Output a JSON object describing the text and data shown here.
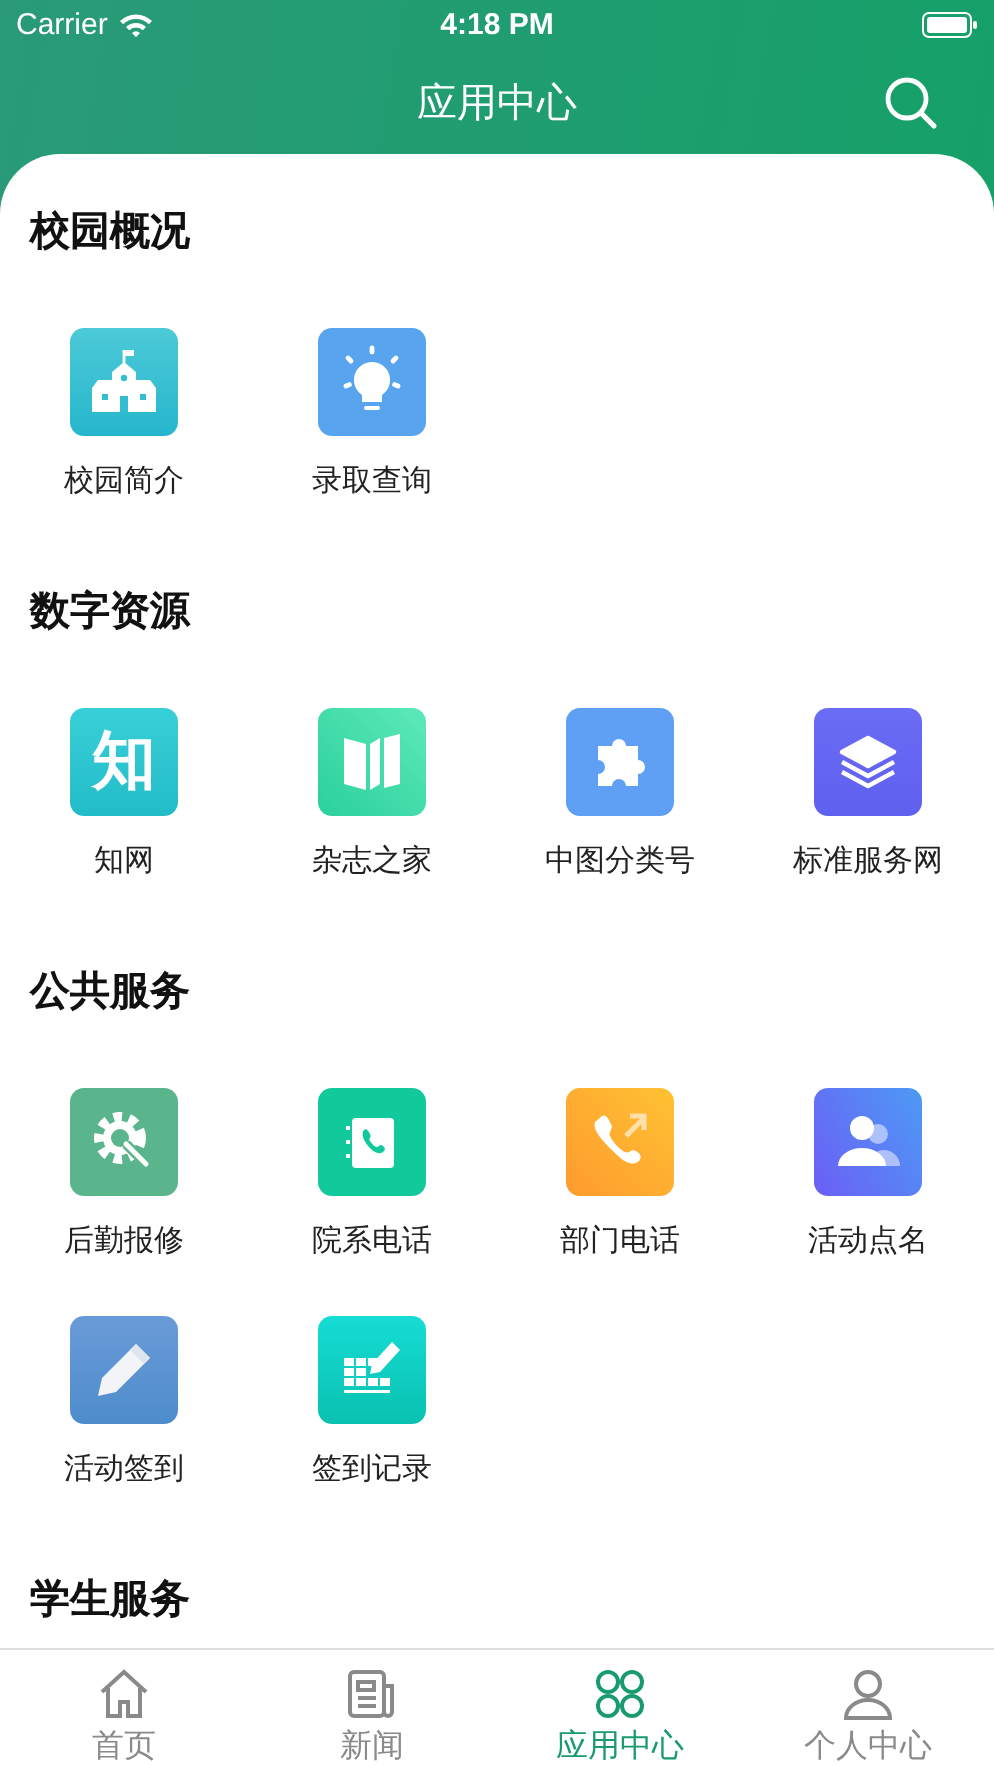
{
  "status_bar": {
    "carrier": "Carrier",
    "time": "4:18 PM"
  },
  "nav_bar": {
    "title": "应用中心"
  },
  "sections": [
    {
      "title": "校园概况",
      "items": [
        {
          "label": "校园简介"
        },
        {
          "label": "录取查询"
        }
      ]
    },
    {
      "title": "数字资源",
      "items": [
        {
          "label": "知网",
          "icon_text": "知"
        },
        {
          "label": "杂志之家"
        },
        {
          "label": "中图分类号"
        },
        {
          "label": "标准服务网"
        }
      ]
    },
    {
      "title": "公共服务",
      "items": [
        {
          "label": "后勤报修"
        },
        {
          "label": "院系电话"
        },
        {
          "label": "部门电话"
        },
        {
          "label": "活动点名"
        },
        {
          "label": "活动签到"
        },
        {
          "label": "签到记录"
        }
      ]
    },
    {
      "title": "学生服务"
    }
  ],
  "tab_bar": [
    {
      "label": "首页",
      "selected": false
    },
    {
      "label": "新闻",
      "selected": false
    },
    {
      "label": "应用中心",
      "selected": true
    },
    {
      "label": "个人中心",
      "selected": false
    }
  ]
}
